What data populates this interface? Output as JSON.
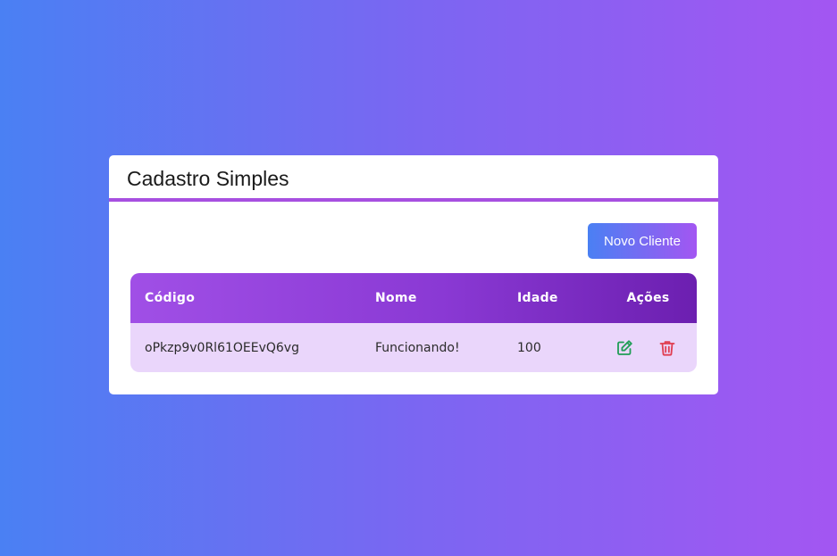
{
  "card": {
    "title": "Cadastro Simples",
    "new_button_label": "Novo Cliente"
  },
  "table": {
    "headers": {
      "code": "Código",
      "name": "Nome",
      "age": "Idade",
      "actions": "Ações"
    },
    "rows": [
      {
        "code": "oPkzp9v0Rl61OEEvQ6vg",
        "name": "Funcionando!",
        "age": "100"
      }
    ]
  },
  "icons": {
    "edit": "edit-icon",
    "delete": "trash-icon"
  },
  "colors": {
    "accent": "#a74fe0",
    "edit_icon": "#1f9d55",
    "delete_icon": "#e03e52",
    "row_background": "#ead6fb"
  }
}
